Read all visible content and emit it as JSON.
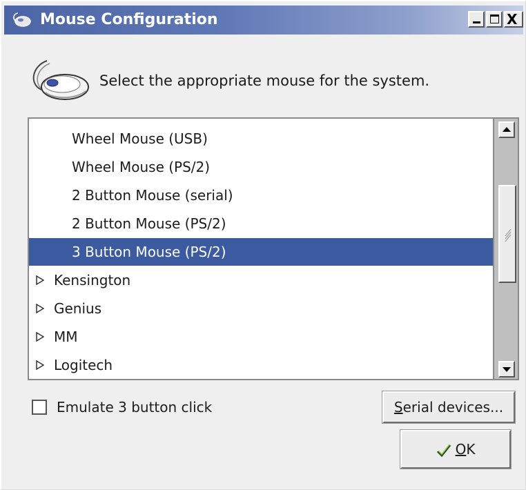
{
  "window": {
    "title": "Mouse Configuration",
    "controls": {
      "minimize": "_",
      "maximize": "□",
      "close": "X"
    }
  },
  "header": {
    "prompt": "Select the appropriate mouse for the system."
  },
  "mouse_list": {
    "items": [
      {
        "label": "Wheel Mouse (USB)",
        "type": "child",
        "selected": false
      },
      {
        "label": "Wheel Mouse (PS/2)",
        "type": "child",
        "selected": false
      },
      {
        "label": "2 Button Mouse (serial)",
        "type": "child",
        "selected": false
      },
      {
        "label": "2 Button Mouse (PS/2)",
        "type": "child",
        "selected": false
      },
      {
        "label": "3 Button Mouse (PS/2)",
        "type": "child",
        "selected": true
      },
      {
        "label": "Kensington",
        "type": "group",
        "expanded": false
      },
      {
        "label": "Genius",
        "type": "group",
        "expanded": false
      },
      {
        "label": "MM",
        "type": "group",
        "expanded": false
      },
      {
        "label": "Logitech",
        "type": "group",
        "expanded": false
      }
    ]
  },
  "options": {
    "emulate_label": "Emulate 3 button click",
    "emulate_checked": false
  },
  "buttons": {
    "serial_devices": {
      "mnemonic": "S",
      "rest": "erial devices..."
    },
    "ok": {
      "mnemonic": "O",
      "rest": "K"
    }
  },
  "colors": {
    "selection": "#3b5aa0",
    "titlebar": "#4c65a6"
  }
}
